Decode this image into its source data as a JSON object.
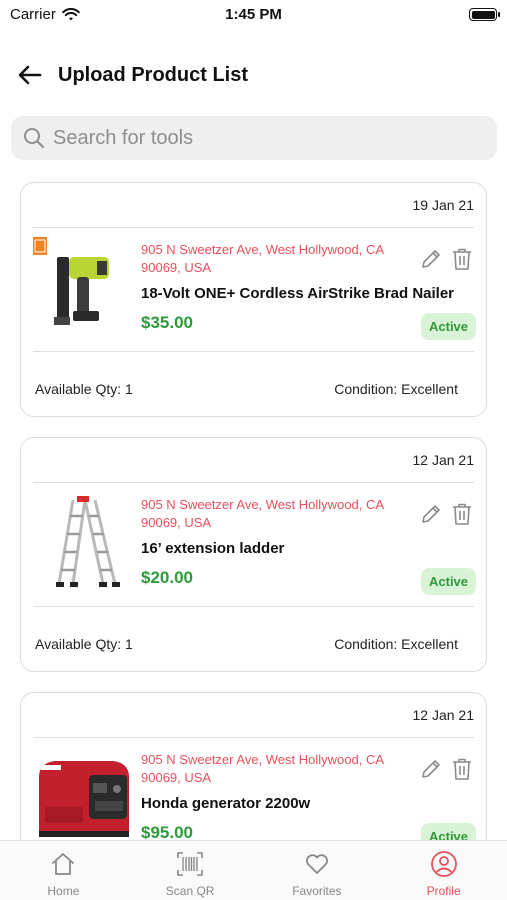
{
  "status_bar": {
    "carrier": "Carrier",
    "time": "1:45 PM"
  },
  "header": {
    "title": "Upload Product List"
  },
  "search": {
    "placeholder": "Search for tools"
  },
  "products": [
    {
      "date": "19 Jan 21",
      "address": "905 N Sweetzer Ave, West Hollywood, CA 90069, USA",
      "name": "18-Volt ONE+ Cordless AirStrike Brad Nailer",
      "price": "$35.00",
      "status": "Active",
      "qty": "Available Qty: 1",
      "condition": "Condition: Excellent",
      "image": "brad-nailer"
    },
    {
      "date": "12 Jan 21",
      "address": "905 N Sweetzer Ave, West Hollywood, CA 90069, USA",
      "name": "16’ extension ladder",
      "price": "$20.00",
      "status": "Active",
      "qty": "Available Qty: 1",
      "condition": "Condition: Excellent",
      "image": "extension-ladder"
    },
    {
      "date": "12 Jan 21",
      "address": "905 N Sweetzer Ave, West Hollywood, CA 90069, USA",
      "name": "Honda generator 2200w",
      "price": "$95.00",
      "status": "Active",
      "qty": "",
      "condition": "",
      "image": "generator"
    }
  ],
  "tabbar": {
    "home": "Home",
    "scan": "Scan QR",
    "favorites": "Favorites",
    "profile": "Profile"
  },
  "colors": {
    "accent": "#e8505b",
    "price_green": "#2e9a3c",
    "badge_bg": "#d9f3d6"
  }
}
